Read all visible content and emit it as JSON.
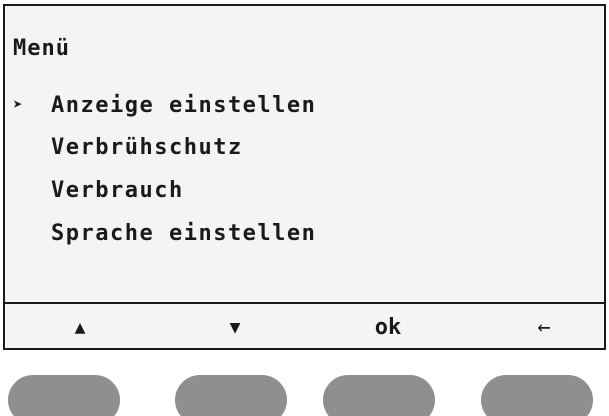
{
  "screen": {
    "title": "Menü",
    "selected_marker": "➤",
    "items": [
      {
        "label": "Anzeige einstellen",
        "selected": true
      },
      {
        "label": "Verbrühschutz",
        "selected": false
      },
      {
        "label": "Verbrauch",
        "selected": false
      },
      {
        "label": "Sprache einstellen",
        "selected": false
      }
    ]
  },
  "softkeys": {
    "up": "▲",
    "down": "▼",
    "ok": "ok",
    "back": "←"
  },
  "colors": {
    "frame": "#1a1a1a",
    "display_bg": "#f4f4f4",
    "button": "#8f8f8f"
  }
}
